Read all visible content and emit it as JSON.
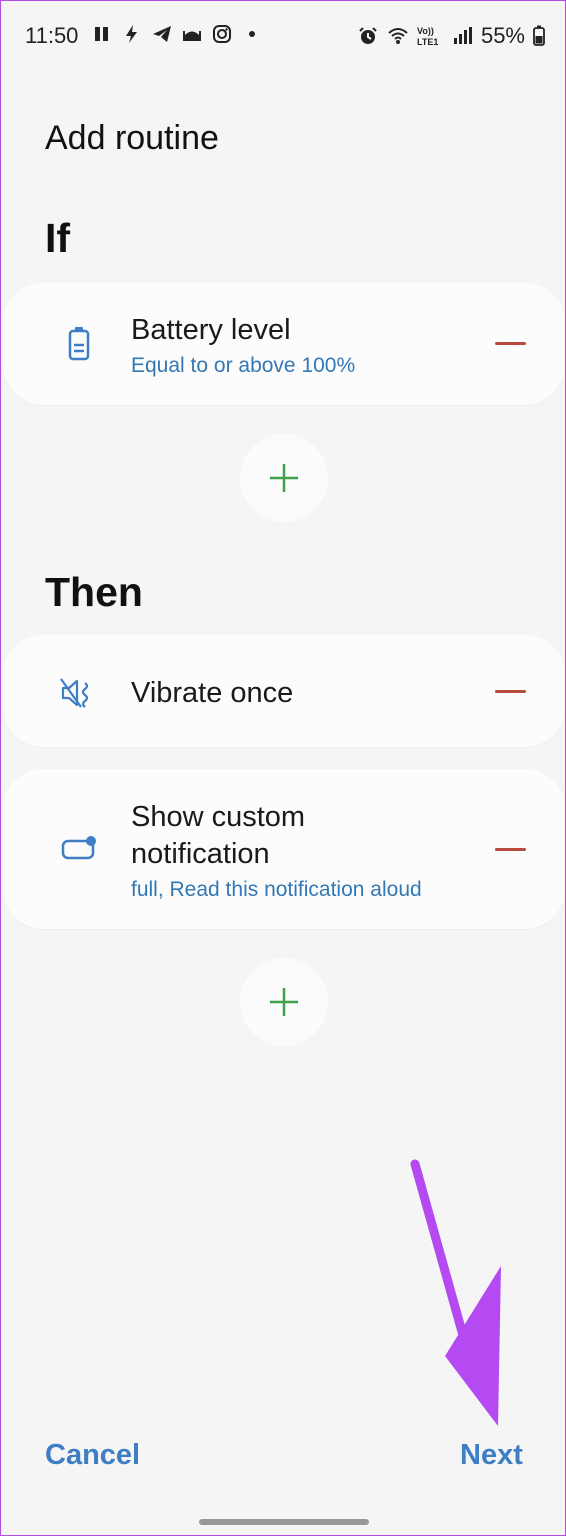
{
  "status_bar": {
    "time": "11:50",
    "battery_text": "55%",
    "left_icons": [
      "pause-icon",
      "flash-icon",
      "telegram-icon",
      "mosque-icon",
      "instagram-icon",
      "dot-icon"
    ],
    "right_icons": [
      "alarm-icon",
      "wifi-icon",
      "volte-icon",
      "signal-icon",
      "battery-icon"
    ],
    "volte_label": "VoLTE1"
  },
  "page_title": "Add routine",
  "if_section": {
    "heading": "If",
    "condition": {
      "title": "Battery level",
      "subtitle": "Equal to or above 100%",
      "icon": "battery-icon"
    }
  },
  "then_section": {
    "heading": "Then",
    "actions": [
      {
        "title": "Vibrate once",
        "icon": "vibrate-icon"
      },
      {
        "title": "Show custom notification",
        "subtitle": "full, Read this notification aloud",
        "icon": "notification-icon"
      }
    ]
  },
  "footer": {
    "cancel_label": "Cancel",
    "next_label": "Next"
  },
  "colors": {
    "accent_blue": "#3d7ec4",
    "subtitle_blue": "#3278b4",
    "remove_red": "#b84a3e",
    "add_green": "#3fa14a",
    "arrow_purple": "#b54af2",
    "background": "#f5f5f5"
  }
}
